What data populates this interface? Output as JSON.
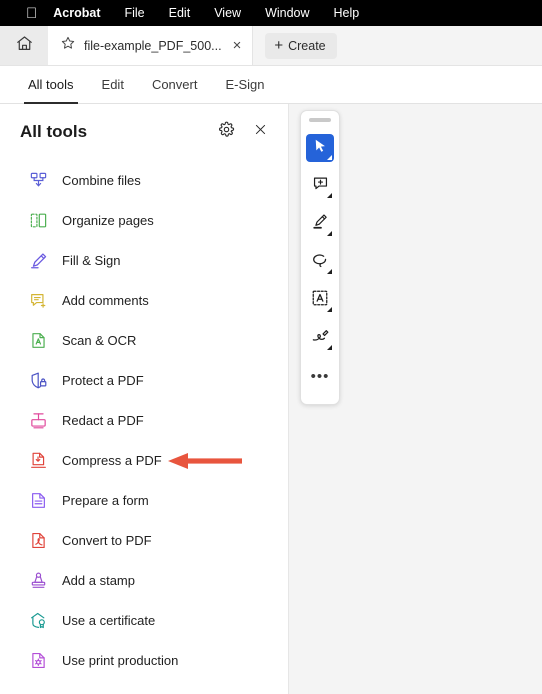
{
  "menubar": {
    "apple_icon": "apple-logo",
    "items": [
      {
        "label": "Acrobat",
        "bold": true
      },
      {
        "label": "File",
        "bold": false
      },
      {
        "label": "Edit",
        "bold": false
      },
      {
        "label": "View",
        "bold": false
      },
      {
        "label": "Window",
        "bold": false
      },
      {
        "label": "Help",
        "bold": false
      }
    ]
  },
  "tabstrip": {
    "home_icon": "home-icon",
    "star_icon": "star-icon",
    "tab_title": "file-example_PDF_500...",
    "close_label": "×",
    "create_label": "Create",
    "create_plus": "+"
  },
  "navtabs": {
    "items": [
      {
        "label": "All tools",
        "active": true
      },
      {
        "label": "Edit",
        "active": false
      },
      {
        "label": "Convert",
        "active": false
      },
      {
        "label": "E-Sign",
        "active": false
      }
    ]
  },
  "panel": {
    "title": "All tools",
    "settings_icon": "gear-icon",
    "close_icon": "close-icon",
    "tools": [
      {
        "label": "Combine files",
        "icon": "combine-files-icon",
        "color": "#5b5fd6"
      },
      {
        "label": "Organize pages",
        "icon": "organize-pages-icon",
        "color": "#4caf50"
      },
      {
        "label": "Fill & Sign",
        "icon": "fill-and-sign-icon",
        "color": "#6a5ae0"
      },
      {
        "label": "Add comments",
        "icon": "add-comments-icon",
        "color": "#d4b534"
      },
      {
        "label": "Scan & OCR",
        "icon": "scan-and-ocr-icon",
        "color": "#4caf50"
      },
      {
        "label": "Protect a PDF",
        "icon": "protect-pdf-icon",
        "color": "#4a52c4"
      },
      {
        "label": "Redact a PDF",
        "icon": "redact-pdf-icon",
        "color": "#e0489c"
      },
      {
        "label": "Compress a PDF",
        "icon": "compress-pdf-icon",
        "color": "#e0443b"
      },
      {
        "label": "Prepare a form",
        "icon": "prepare-form-icon",
        "color": "#8b5cf0"
      },
      {
        "label": "Convert to PDF",
        "icon": "convert-to-pdf-icon",
        "color": "#e0443b"
      },
      {
        "label": "Add a stamp",
        "icon": "add-stamp-icon",
        "color": "#9b4fd0"
      },
      {
        "label": "Use a certificate",
        "icon": "use-certificate-icon",
        "color": "#1a9a92"
      },
      {
        "label": "Use print production",
        "icon": "print-production-icon",
        "color": "#b44fd8"
      }
    ]
  },
  "floating_toolbar": {
    "grabber": "drag-handle",
    "buttons": [
      {
        "icon": "selection-cursor-icon",
        "selected": true,
        "has_dropdown": true
      },
      {
        "icon": "add-comment-icon",
        "selected": false,
        "has_dropdown": true
      },
      {
        "icon": "highlighter-icon",
        "selected": false,
        "has_dropdown": true
      },
      {
        "icon": "lasso-select-icon",
        "selected": false,
        "has_dropdown": true
      },
      {
        "icon": "text-select-icon",
        "selected": false,
        "has_dropdown": true
      },
      {
        "icon": "draw-pen-icon",
        "selected": false,
        "has_dropdown": true
      },
      {
        "icon": "more-options-icon",
        "selected": false,
        "has_dropdown": false,
        "glyph": "•••"
      }
    ]
  },
  "annotation": {
    "arrow_color": "#e8553e",
    "points_to": "Compress a PDF"
  },
  "colors": {
    "menubar_bg": "#000000",
    "doc_bg": "#f4f4f4",
    "panel_bg": "#ffffff",
    "accent_blue": "#2563d9"
  }
}
